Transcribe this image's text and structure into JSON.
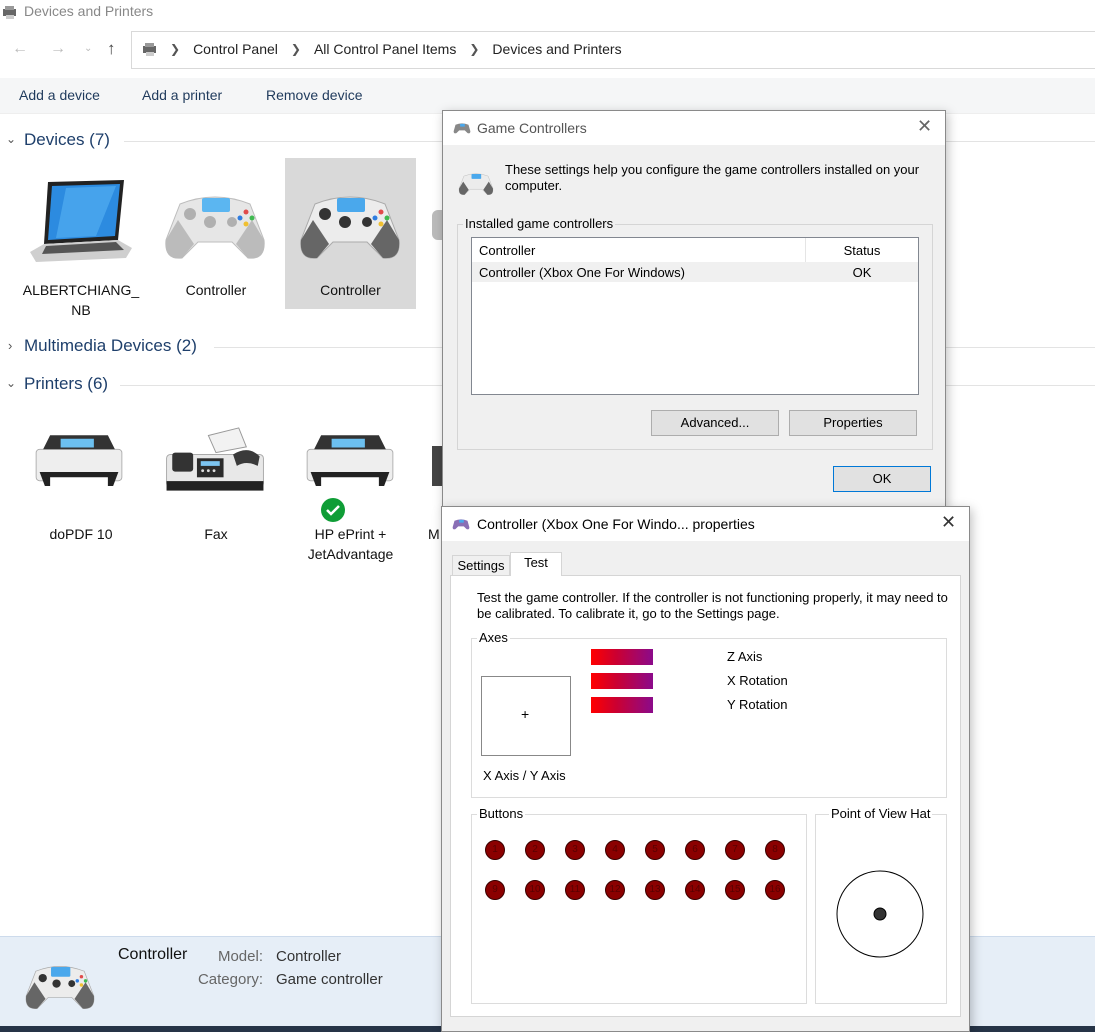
{
  "window": {
    "title": "Devices and Printers"
  },
  "breadcrumbs": [
    "Control Panel",
    "All Control Panel Items",
    "Devices and Printers"
  ],
  "commands": {
    "add_device": "Add a device",
    "add_printer": "Add a printer",
    "remove_device": "Remove device"
  },
  "groups": {
    "devices": "Devices  (7)",
    "multimedia": "Multimedia Devices  (2)",
    "printers": "Printers  (6)"
  },
  "devices": [
    {
      "label_1": "ALBERTCHIANG_",
      "label_2": "NB",
      "icon": "laptop-icon"
    },
    {
      "label_1": "Controller",
      "icon": "gamepad-icon"
    },
    {
      "label_1": "Controller",
      "icon": "gamepad-icon",
      "selected": true
    }
  ],
  "printers": [
    {
      "label_1": "doPDF 10",
      "icon": "printer-icon"
    },
    {
      "label_1": "Fax",
      "icon": "fax-icon"
    },
    {
      "label_1": "HP ePrint +",
      "label_2": "JetAdvantage",
      "icon": "printer-icon",
      "default": true
    },
    {
      "label_1": "M"
    }
  ],
  "statusbar": {
    "name": "Controller",
    "model_key": "Model:",
    "model_value": "Controller",
    "category_key": "Category:",
    "category_value": "Game controller"
  },
  "game_controllers": {
    "title": "Game Controllers",
    "description": "These settings help you configure the game controllers installed on your computer.",
    "group_label": "Installed game controllers",
    "columns": [
      "Controller",
      "Status"
    ],
    "rows": [
      {
        "controller": "Controller (Xbox One For Windows)",
        "status": "OK"
      }
    ],
    "advanced": "Advanced...",
    "properties": "Properties",
    "ok": "OK"
  },
  "properties": {
    "title": "Controller (Xbox One For Windo... properties",
    "tabs": [
      "Settings",
      "Test"
    ],
    "active_tab": "Test",
    "instructions": "Test the game controller.  If the controller is not functioning properly, it may need to be calibrated.  To calibrate it, go to the Settings page.",
    "axes_label": "Axes",
    "xy_label": "X Axis / Y Axis",
    "crosshair": "+",
    "axis_bars": [
      "Z Axis",
      "X Rotation",
      "Y Rotation"
    ],
    "buttons_label": "Buttons",
    "buttons": [
      "1",
      "2",
      "3",
      "4",
      "5",
      "6",
      "7",
      "8",
      "9",
      "10",
      "11",
      "12",
      "13",
      "14",
      "15",
      "16"
    ],
    "pov_label": "Point of View Hat"
  },
  "colors": {
    "accent": "#0078d7",
    "group_text": "#1e3f6b",
    "button_red": "#8b0000",
    "statusbar_bg": "#e6eef7",
    "selected_bg": "#d9d9d9"
  }
}
